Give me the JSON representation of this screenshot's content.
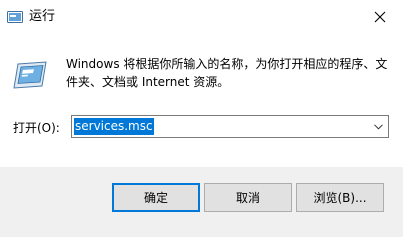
{
  "window": {
    "title": "运行",
    "title_icon": "run-icon",
    "close_icon": "close-icon"
  },
  "content": {
    "description": "Windows 将根据你所输入的名称，为你打开相应的程序、文件夹、文档或 Internet 资源。",
    "open_label": "打开(O):",
    "open_value": "services.msc",
    "dropdown_icon": "chevron-down-icon"
  },
  "buttons": {
    "ok": "确定",
    "cancel": "取消",
    "browse": "浏览(B)..."
  },
  "colors": {
    "selection": "#0078d7",
    "footer_bg": "#f0f0f0",
    "button_bg": "#e1e1e1"
  }
}
